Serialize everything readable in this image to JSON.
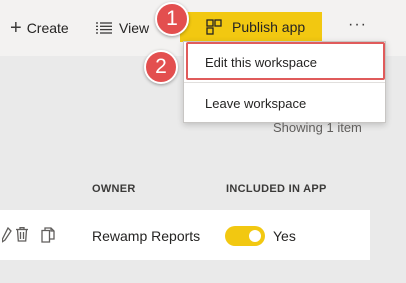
{
  "toolbar": {
    "create_label": "Create",
    "view_label": "View",
    "publish_label": "Publish app",
    "more_label": "···",
    "publish_color": "#f2c811"
  },
  "menu": {
    "items": [
      {
        "label": "Edit this workspace"
      },
      {
        "label": "Leave workspace"
      }
    ]
  },
  "callouts": [
    "1",
    "2"
  ],
  "callout_color": "#e34f4f",
  "list": {
    "showing_text": "Showing 1 item",
    "columns": {
      "owner": "OWNER",
      "included": "INCLUDED IN APP"
    },
    "rows": [
      {
        "owner": "Rewamp Reports",
        "included": "Yes",
        "included_on": true
      }
    ]
  },
  "icons": [
    "plus-icon",
    "list-view-icon",
    "publish-app-icon",
    "more-icon",
    "edit-icon",
    "delete-icon",
    "copy-icon"
  ]
}
